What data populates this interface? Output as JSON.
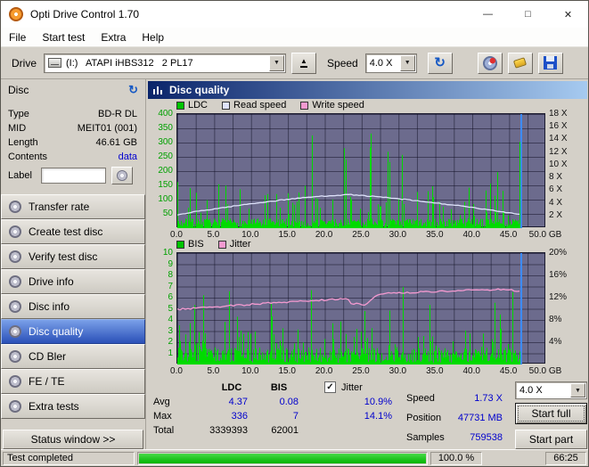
{
  "window": {
    "title": "Opti Drive Control 1.70",
    "controls": {
      "minimize": "—",
      "maximize": "□",
      "close": "✕"
    }
  },
  "menu": {
    "items": [
      "File",
      "Start test",
      "Extra",
      "Help"
    ]
  },
  "toolbar": {
    "drive_label": "Drive",
    "drive_value": "(I:)   ATAPI iHBS312   2 PL17",
    "speed_label": "Speed",
    "speed_value": "4.0 X"
  },
  "sidebar": {
    "disc_header": "Disc",
    "info": [
      {
        "label": "Type",
        "value": "BD-R DL"
      },
      {
        "label": "MID",
        "value": "MEIT01 (001)"
      },
      {
        "label": "Length",
        "value": "46.61 GB"
      },
      {
        "label": "Contents",
        "value": "data"
      }
    ],
    "label_row": {
      "label": "Label",
      "value": ""
    },
    "nav": [
      {
        "label": "Transfer rate"
      },
      {
        "label": "Create test disc"
      },
      {
        "label": "Verify test disc"
      },
      {
        "label": "Drive info"
      },
      {
        "label": "Disc info"
      },
      {
        "label": "Disc quality",
        "active": true
      },
      {
        "label": "CD Bler"
      },
      {
        "label": "FE / TE"
      },
      {
        "label": "Extra tests"
      }
    ],
    "status_window_button": "Status window >>"
  },
  "panel": {
    "title": "Disc quality"
  },
  "chart_data": [
    {
      "type": "bar",
      "title": "LDC errors with read speed overlay",
      "legend": [
        {
          "label": "LDC",
          "color": "#00c400"
        },
        {
          "label": "Read speed",
          "color": "#dfe3fb"
        },
        {
          "label": "Write speed",
          "color": "#f49ad0"
        }
      ],
      "y_left": {
        "ticks": [
          400,
          350,
          300,
          250,
          200,
          150,
          100,
          50
        ],
        "max": 400
      },
      "y_right": {
        "ticks": [
          "18 X",
          "16 X",
          "14 X",
          "12 X",
          "10 X",
          "8 X",
          "6 X",
          "4 X",
          "2 X"
        ],
        "max": 18
      },
      "x": {
        "ticks": [
          "0.0",
          "5.0",
          "10.0",
          "15.0",
          "20.0",
          "25.0",
          "30.0",
          "35.0",
          "40.0",
          "45.0",
          "50.0 GB"
        ],
        "max_gb": 50,
        "data_end_gb": 46.6
      },
      "spikes": {
        "seed": 7,
        "value_max": 400,
        "levels": [
          [
            0.05,
            150,
            336
          ],
          [
            0.17,
            40,
            150
          ],
          [
            1,
            3,
            34
          ]
        ]
      },
      "curve": {
        "name": "Read speed",
        "color": "#dfe3fb",
        "noise": 0.14,
        "points": [
          [
            0,
            2.1
          ],
          [
            3,
            2.7
          ],
          [
            6,
            3.2
          ],
          [
            9,
            3.7
          ],
          [
            12,
            4.15
          ],
          [
            15,
            4.55
          ],
          [
            18,
            4.9
          ],
          [
            21,
            5.15
          ],
          [
            23.3,
            5.3
          ],
          [
            25,
            5.15
          ],
          [
            28,
            4.85
          ],
          [
            31,
            4.5
          ],
          [
            34,
            4.1
          ],
          [
            37,
            3.7
          ],
          [
            40,
            3.25
          ],
          [
            43,
            2.75
          ],
          [
            45.5,
            2.35
          ],
          [
            46.6,
            2.15
          ]
        ]
      },
      "position_line_gb": 46.6,
      "summary": {
        "avg": 4.37,
        "max": 336,
        "total": 3339393
      }
    },
    {
      "type": "bar",
      "title": "BIS errors with jitter overlay",
      "legend": [
        {
          "label": "BIS",
          "color": "#00c400"
        },
        {
          "label": "Jitter",
          "color": "#f49ad0"
        }
      ],
      "y_left": {
        "ticks": [
          10,
          9,
          8,
          7,
          6,
          5,
          4,
          3,
          2,
          1
        ],
        "max": 10
      },
      "y_right": {
        "ticks": [
          "20%",
          "16%",
          "12%",
          "8%",
          "4%"
        ],
        "max": 20
      },
      "x": {
        "ticks": [
          "0.0",
          "5.0",
          "10.0",
          "15.0",
          "20.0",
          "25.0",
          "30.0",
          "35.0",
          "40.0",
          "45.0",
          "50.0 GB"
        ],
        "max_gb": 50,
        "data_end_gb": 46.6
      },
      "spikes": {
        "seed": 13,
        "value_max": 10,
        "levels": [
          [
            0.06,
            3.5,
            7
          ],
          [
            0.2,
            1.4,
            3.4
          ],
          [
            1,
            0.15,
            1.5
          ]
        ]
      },
      "curve": {
        "name": "Jitter",
        "color": "#f49ad0",
        "noise": 0.3,
        "points": [
          [
            0,
            9.9
          ],
          [
            4,
            10.3
          ],
          [
            8,
            10.6
          ],
          [
            12,
            11.0
          ],
          [
            16,
            11.3
          ],
          [
            20,
            11.6
          ],
          [
            23,
            11.8
          ],
          [
            23.6,
            10.9
          ],
          [
            25.5,
            10.8
          ],
          [
            27,
            12.5
          ],
          [
            29,
            12.8
          ],
          [
            33,
            13.0
          ],
          [
            37,
            13.2
          ],
          [
            41,
            13.4
          ],
          [
            44,
            13.5
          ],
          [
            46.6,
            13.2
          ]
        ]
      },
      "position_line_gb": 46.6,
      "summary": {
        "avg": 0.08,
        "max": 7,
        "total": 62001,
        "jitter_avg": "10.9%",
        "jitter_max": "14.1%"
      }
    }
  ],
  "stats": {
    "col_headers": [
      "LDC",
      "BIS"
    ],
    "rows": [
      {
        "label": "Avg",
        "ldc": "4.37",
        "bis": "0.08"
      },
      {
        "label": "Max",
        "ldc": "336",
        "bis": "7"
      },
      {
        "label": "Total",
        "ldc": "3339393",
        "bis": "62001"
      }
    ],
    "jitter": {
      "label": "Jitter",
      "checked": true,
      "mark": "✓",
      "values": [
        "10.9%",
        "14.1%"
      ]
    },
    "info": [
      {
        "label": "Speed",
        "value": "1.73 X"
      },
      {
        "label": "Position",
        "value": "47731 MB"
      },
      {
        "label": "Samples",
        "value": "759538"
      }
    ],
    "speed_select": "4.0 X",
    "start_full": "Start full",
    "start_part": "Start part"
  },
  "statusbar": {
    "status": "Test completed",
    "progress_value": 100,
    "percent": "100.0 %",
    "time": "66:25"
  }
}
